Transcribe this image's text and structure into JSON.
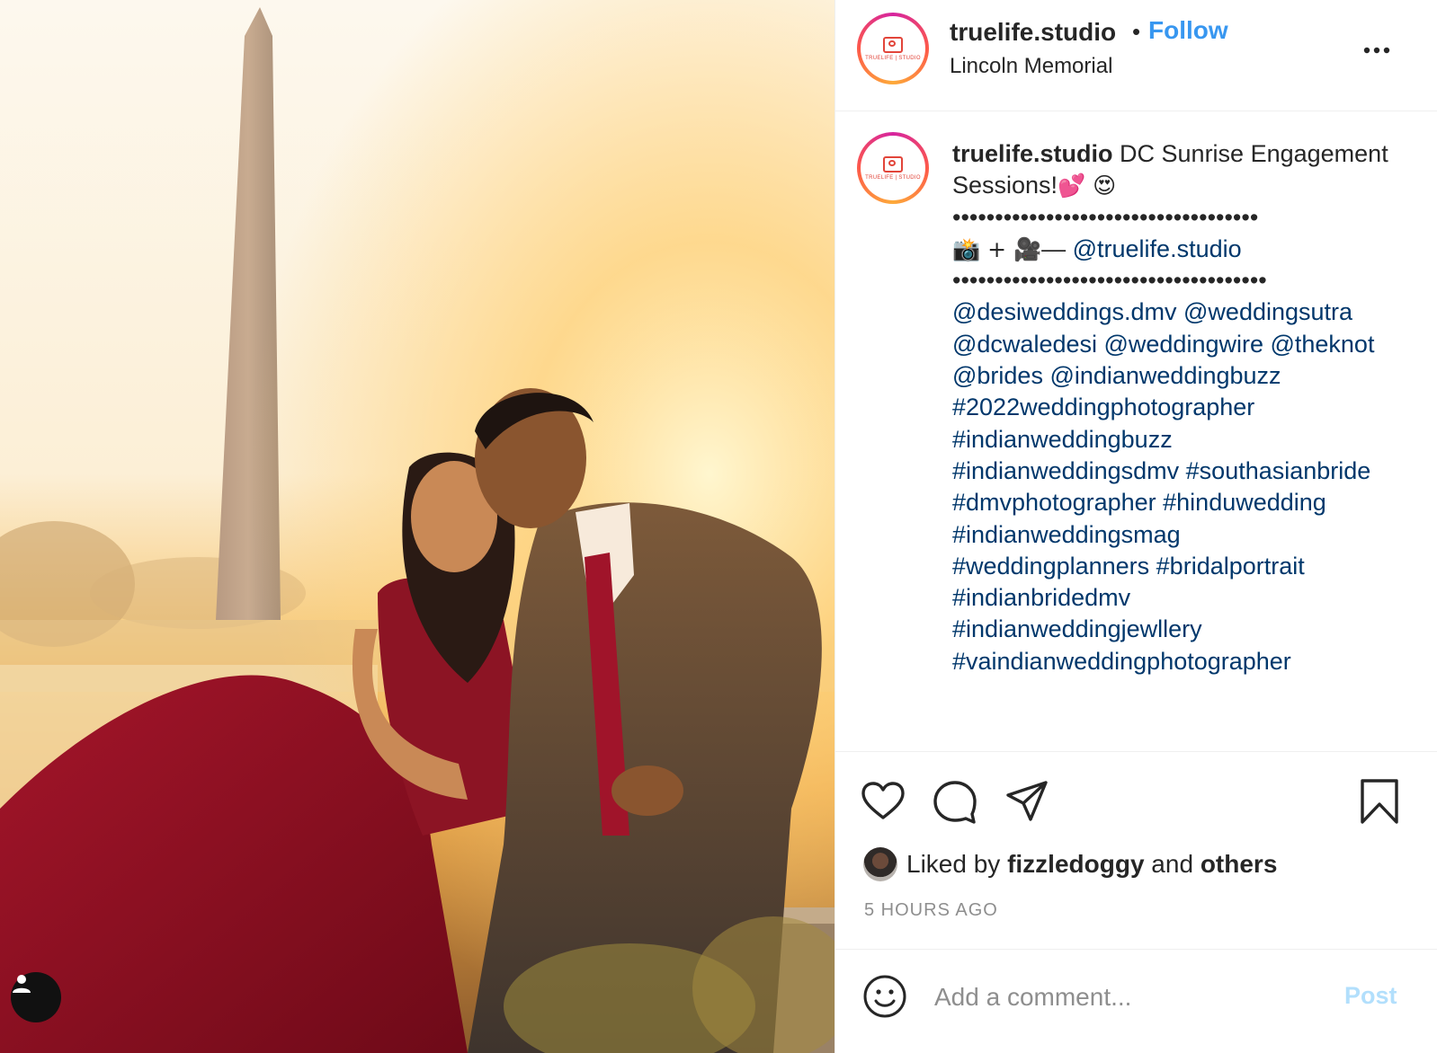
{
  "post": {
    "username": "truelife.studio",
    "separator": "•",
    "follow_label": "Follow",
    "location": "Lincoln Memorial",
    "avatar_text": "TRUELIFE | STUDIO"
  },
  "caption": {
    "username": "truelife.studio",
    "title": "DC Sunrise Engagement Sessions!",
    "title_emojis": "💕 😍",
    "divider_1": "••••••••••••••••••••••••••••••••••••",
    "credit_emojis": "📸 + 🎥",
    "credit_dash": "— ",
    "credit_handle": "@truelife.studio",
    "divider_2": "•••••••••••••••••••••••••••••••••••••",
    "tag_lines": [
      "@desiweddings.dmv @weddingsutra",
      "@dcwaledesi @weddingwire @theknot",
      "@brides @indianweddingbuzz",
      "#2022weddingphotographer",
      "#indianweddingbuzz",
      "#indianweddingsdmv #southasianbride",
      "#dmvphotographer #hinduwedding",
      "#indianweddingsmag",
      "#weddingplanners #bridalportrait",
      "#indianbridedmv",
      "#indianweddingjewllery",
      "#vaindianweddingphotographer"
    ]
  },
  "engagement": {
    "liked_by_prefix": "Liked by ",
    "liked_by_user": "fizzledoggy",
    "liked_by_and": " and ",
    "liked_by_others": "others",
    "time_ago": "5 HOURS AGO"
  },
  "comment": {
    "placeholder": "Add a comment...",
    "post_label": "Post"
  },
  "icons": {
    "like": "heart-icon",
    "comment": "comment-icon",
    "share": "share-icon",
    "save": "bookmark-icon",
    "more": "more-icon",
    "emoji": "smile-icon",
    "user_tags": "user-icon"
  },
  "colors": {
    "follow": "#3897f0",
    "link": "#00376b",
    "post_disabled": "#b2dffc",
    "muted": "#8e8e8e"
  }
}
